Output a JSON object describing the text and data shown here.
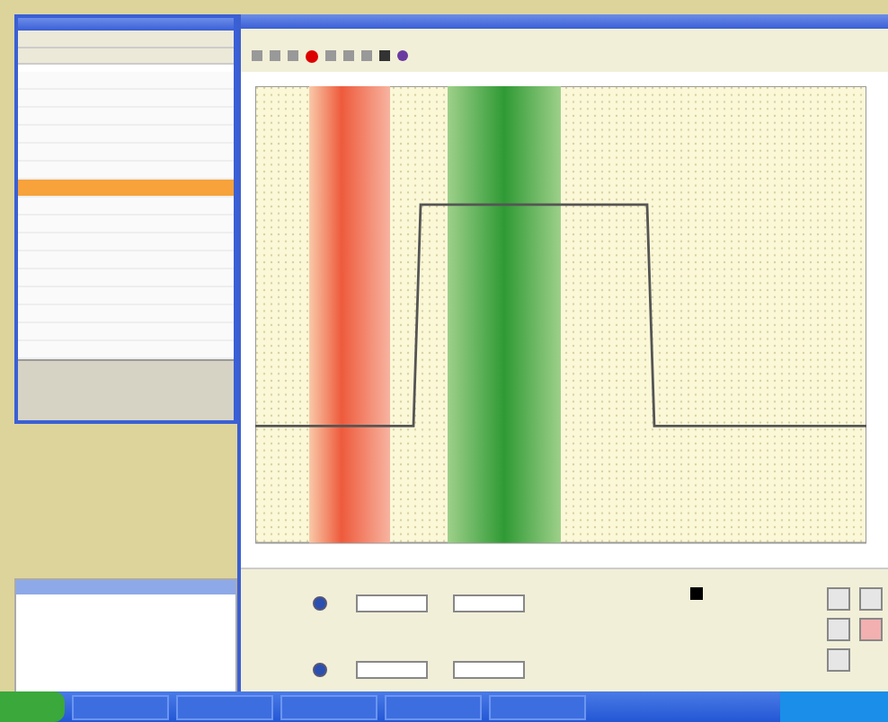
{
  "main_window": {
    "options": [
      {
        "selected": true
      },
      {
        "selected": true
      }
    ],
    "color_swatch": {
      "color": "#000000"
    }
  },
  "property_window": {
    "rows": [
      {
        "selected": false
      },
      {
        "selected": false
      },
      {
        "selected": false
      },
      {
        "selected": false
      },
      {
        "selected": false
      },
      {
        "selected": false
      },
      {
        "selected": true
      },
      {
        "selected": false
      },
      {
        "selected": false
      },
      {
        "selected": false
      },
      {
        "selected": false
      },
      {
        "selected": false
      },
      {
        "selected": false
      },
      {
        "selected": false
      },
      {
        "selected": false
      },
      {
        "selected": false
      }
    ]
  },
  "taskbar": {
    "tasks": [
      {
        "selected": false
      },
      {
        "selected": false
      },
      {
        "selected": false
      },
      {
        "selected": false
      },
      {
        "selected": false
      }
    ]
  }
}
